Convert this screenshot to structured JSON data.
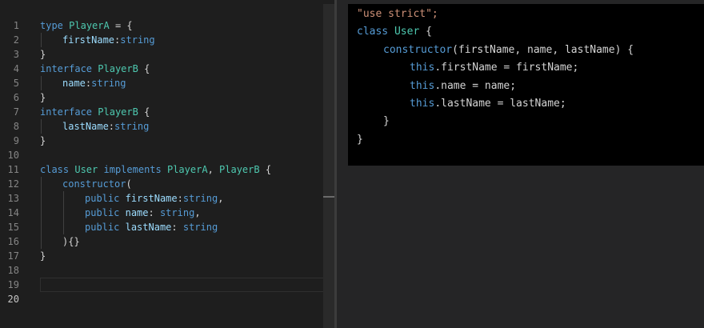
{
  "editor": {
    "active_line": "20",
    "lines": [
      {
        "n": "1"
      },
      {
        "n": "2",
        "t1": "type",
        "t2": " ",
        "t3": "PlayerA",
        "t4": " = {"
      },
      {
        "n": "3",
        "a": "firstName",
        "b": ":",
        "c": "string"
      },
      {
        "n": "4",
        "t": "}"
      },
      {
        "n": "5",
        "t1": "interface",
        "t2": " ",
        "t3": "PlayerB",
        "t4": " {"
      },
      {
        "n": "6",
        "a": "name",
        "b": ":",
        "c": "string"
      },
      {
        "n": "7",
        "t": "}"
      },
      {
        "n": "8",
        "t1": "interface",
        "t2": " ",
        "t3": "PlayerB",
        "t4": " {"
      },
      {
        "n": "9",
        "a": "lastName",
        "b": ":",
        "c": "string"
      },
      {
        "n": "10",
        "t": "}"
      },
      {
        "n": "11"
      },
      {
        "n": "12",
        "k1": "class",
        "s1": " ",
        "c1": "User",
        "s2": " ",
        "k2": "implements",
        "s3": " ",
        "c2": "PlayerA",
        "s4": ", ",
        "c3": "PlayerB",
        "s5": " {"
      },
      {
        "n": "13",
        "k": "constructor",
        "p": "("
      },
      {
        "n": "14",
        "m": "public",
        "sp": " ",
        "a": "firstName",
        "b": ":",
        "c": "string",
        "e": ","
      },
      {
        "n": "15",
        "m": "public",
        "sp": " ",
        "a": "name",
        "b": ": ",
        "c": "string",
        "e": ","
      },
      {
        "n": "16",
        "m": "public",
        "sp": " ",
        "a": "lastName",
        "b": ": ",
        "c": "string",
        "e": ""
      },
      {
        "n": "17",
        "t": "){}"
      },
      {
        "n": "18",
        "t": "}"
      },
      {
        "n": "19"
      },
      {
        "n": "20"
      }
    ]
  },
  "output": {
    "l1": "\"use strict\";",
    "l2_kw": "class",
    "l2_name": "User",
    "l2_rest": " {",
    "l3_fn": "constructor",
    "l3_rest": "(firstName, name, lastName) {",
    "l4_this": "this",
    "l4_rest": ".firstName = firstName;",
    "l5_this": "this",
    "l5_rest": ".name = name;",
    "l6_this": "this",
    "l6_rest": ".lastName = lastName;",
    "l7": "}",
    "l8": "}"
  }
}
